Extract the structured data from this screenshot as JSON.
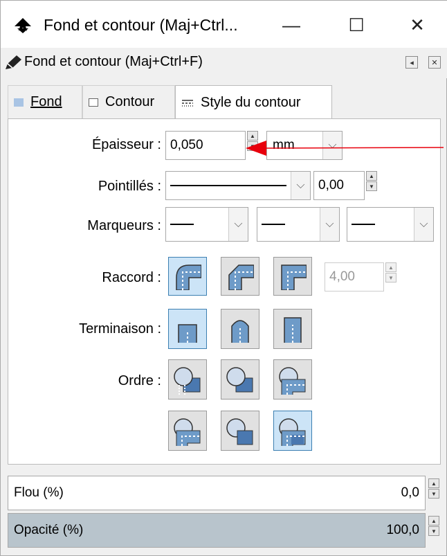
{
  "window": {
    "title": "Fond et contour (Maj+Ctrl...",
    "minimize": "—",
    "maximize": "☐",
    "close": "✕"
  },
  "dock": {
    "title": "Fond et contour (Maj+Ctrl+F)",
    "left_btn": "◂",
    "close_btn": "✕"
  },
  "tabs": [
    {
      "label": "Fond",
      "mnemonic": "F"
    },
    {
      "label": "Contour"
    },
    {
      "label": "Style du contour"
    }
  ],
  "stroke_style": {
    "width": {
      "label": "Épaisseur :",
      "value": "0,050",
      "unit": "mm"
    },
    "dashes": {
      "label": "Pointillés :",
      "offset": "0,00"
    },
    "markers": {
      "label": "Marqueurs :"
    },
    "join": {
      "label": "Raccord :",
      "miter_limit": "4,00",
      "selected": "round"
    },
    "cap": {
      "label": "Terminaison :",
      "selected": "butt"
    },
    "order": {
      "label": "Ordre :",
      "selected": 6
    }
  },
  "blur": {
    "label": "Flou (%)",
    "value": "0,0"
  },
  "opacity": {
    "label": "Opacité (%)",
    "value": "100,0",
    "level": 1.0
  },
  "accent": "#3c7fb1",
  "annotation_color": "#e8000c"
}
